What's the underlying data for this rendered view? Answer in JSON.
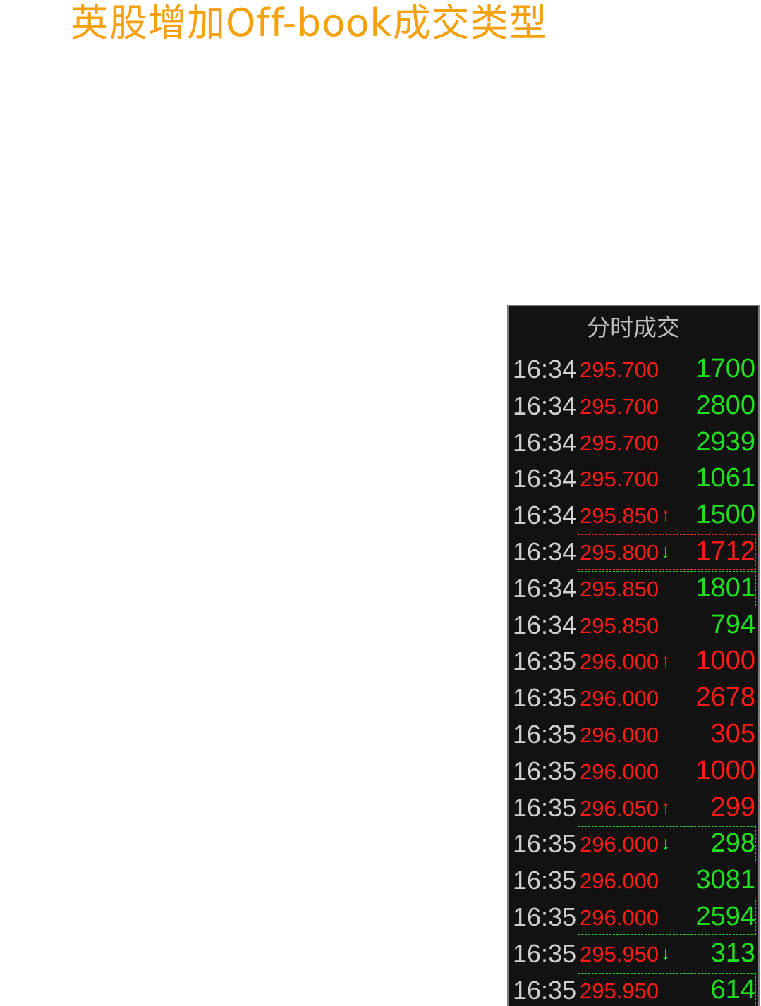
{
  "title": "英股增加Off-book成交类型",
  "panel": {
    "header": "分时成交",
    "rows": [
      {
        "time": "16:34",
        "price": "295.700",
        "arrow": "",
        "arrow_color": "",
        "volume": "1700",
        "volume_color": "green",
        "box": ""
      },
      {
        "time": "16:34",
        "price": "295.700",
        "arrow": "",
        "arrow_color": "",
        "volume": "2800",
        "volume_color": "green",
        "box": ""
      },
      {
        "time": "16:34",
        "price": "295.700",
        "arrow": "",
        "arrow_color": "",
        "volume": "2939",
        "volume_color": "green",
        "box": ""
      },
      {
        "time": "16:34",
        "price": "295.700",
        "arrow": "",
        "arrow_color": "",
        "volume": "1061",
        "volume_color": "green",
        "box": ""
      },
      {
        "time": "16:34",
        "price": "295.850",
        "arrow": "↑",
        "arrow_color": "red",
        "volume": "1500",
        "volume_color": "green",
        "box": ""
      },
      {
        "time": "16:34",
        "price": "295.800",
        "arrow": "↓",
        "arrow_color": "green",
        "volume": "1712",
        "volume_color": "red",
        "box": "red"
      },
      {
        "time": "16:34",
        "price": "295.850",
        "arrow": "",
        "arrow_color": "",
        "volume": "1801",
        "volume_color": "green",
        "box": "green"
      },
      {
        "time": "16:34",
        "price": "295.850",
        "arrow": "",
        "arrow_color": "",
        "volume": "794",
        "volume_color": "green",
        "box": ""
      },
      {
        "time": "16:35",
        "price": "296.000",
        "arrow": "↑",
        "arrow_color": "red",
        "volume": "1000",
        "volume_color": "red",
        "box": ""
      },
      {
        "time": "16:35",
        "price": "296.000",
        "arrow": "",
        "arrow_color": "",
        "volume": "2678",
        "volume_color": "red",
        "box": ""
      },
      {
        "time": "16:35",
        "price": "296.000",
        "arrow": "",
        "arrow_color": "",
        "volume": "305",
        "volume_color": "red",
        "box": ""
      },
      {
        "time": "16:35",
        "price": "296.000",
        "arrow": "",
        "arrow_color": "",
        "volume": "1000",
        "volume_color": "red",
        "box": ""
      },
      {
        "time": "16:35",
        "price": "296.050",
        "arrow": "↑",
        "arrow_color": "red",
        "volume": "299",
        "volume_color": "red",
        "box": ""
      },
      {
        "time": "16:35",
        "price": "296.000",
        "arrow": "↓",
        "arrow_color": "green",
        "volume": "298",
        "volume_color": "green",
        "box": "green"
      },
      {
        "time": "16:35",
        "price": "296.000",
        "arrow": "",
        "arrow_color": "",
        "volume": "3081",
        "volume_color": "green",
        "box": ""
      },
      {
        "time": "16:35",
        "price": "296.000",
        "arrow": "",
        "arrow_color": "",
        "volume": "2594",
        "volume_color": "green",
        "box": "green"
      },
      {
        "time": "16:35",
        "price": "295.950",
        "arrow": "↓",
        "arrow_color": "green",
        "volume": "313",
        "volume_color": "green",
        "box": ""
      },
      {
        "time": "16:35",
        "price": "295.950",
        "arrow": "",
        "arrow_color": "",
        "volume": "614",
        "volume_color": "green",
        "box": "green"
      }
    ]
  },
  "colors": {
    "title": "#f5a00f",
    "up": "#ff1a1a",
    "down": "#21e021",
    "time": "#cfcfcf",
    "panel_bg": "#121212"
  }
}
